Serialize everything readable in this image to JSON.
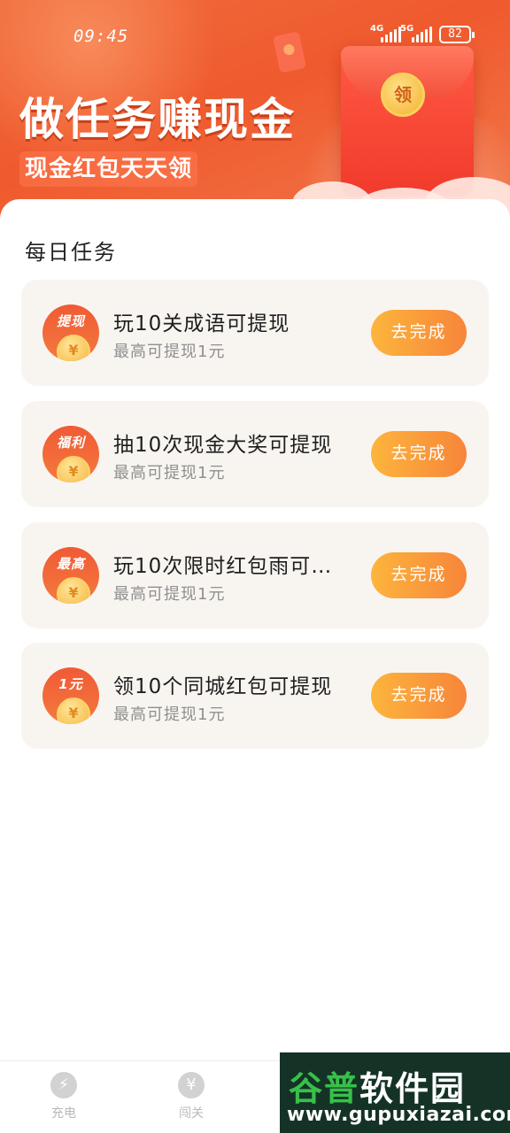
{
  "status_bar": {
    "time": "09:45",
    "net1": "4G",
    "net2": "5G",
    "battery": "82"
  },
  "banner": {
    "title": "做任务赚现金",
    "subtitle": "现金红包天天领",
    "envelope_coin": "领"
  },
  "section_title": "每日任务",
  "tasks": [
    {
      "badge": "提现",
      "title": "玩10关成语可提现",
      "sub": "最高可提现1元",
      "button": "去完成"
    },
    {
      "badge": "福利",
      "title": "抽10次现金大奖可提现",
      "sub": "最高可提现1元",
      "button": "去完成"
    },
    {
      "badge": "最高",
      "title": "玩10次限时红包雨可…",
      "sub": "最高可提现1元",
      "button": "去完成"
    },
    {
      "badge": "1元",
      "title": "领10个同城红包可提现",
      "sub": "最高可提现1元",
      "button": "去完成"
    }
  ],
  "coin_symbol": "¥",
  "bottom_nav": [
    {
      "label": "充电",
      "icon": "lightning-icon"
    },
    {
      "label": "闯关",
      "icon": "money-bag-icon"
    }
  ],
  "watermark": {
    "brand_a": "谷普",
    "brand_b": "软件园",
    "url": "www.gupuxiazai.com"
  },
  "colors": {
    "banner": "#ef5a2e",
    "button_start": "#fdb53c",
    "button_end": "#f7853a",
    "card_bg": "#f8f5f1"
  }
}
